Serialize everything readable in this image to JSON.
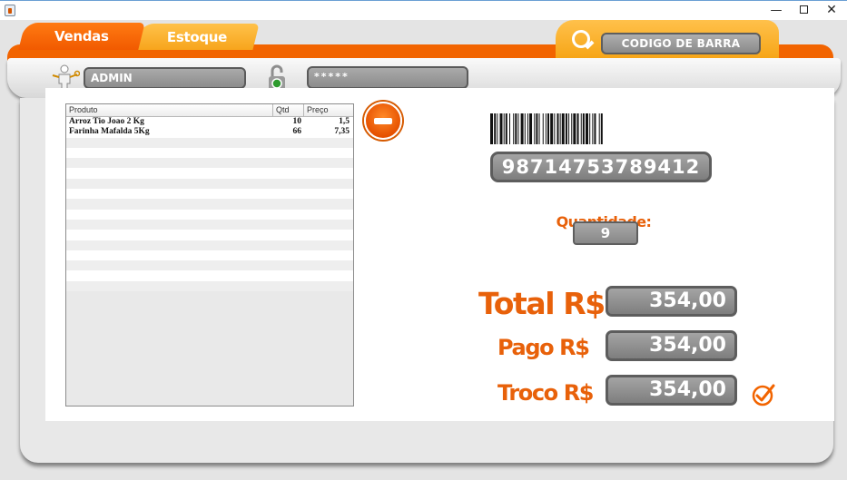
{
  "window": {
    "minimize_glyph": "—",
    "close_glyph": "✕",
    "icons": {
      "app": "java-app-icon",
      "maximize": "maximize-icon"
    }
  },
  "tabs": [
    {
      "label": "Vendas",
      "active": true
    },
    {
      "label": "Estoque",
      "active": false
    }
  ],
  "barcode_search": {
    "label": "CODIGO DE BARRA",
    "icon": "search-icon"
  },
  "login": {
    "user_value": "ADMIN",
    "password_value": "*****",
    "icons": {
      "user": "user-with-key-icon",
      "lock": "unlocked-padlock-icon"
    }
  },
  "table": {
    "columns": [
      "Produto",
      "Qtd",
      "Preço"
    ],
    "rows": [
      [
        "Arroz Tio Joao 2 Kg",
        "10",
        "1,5"
      ],
      [
        "Farinha Mafalda 5Kg",
        "66",
        "7,35"
      ]
    ]
  },
  "remove_button": {
    "icon": "minus-circle-icon"
  },
  "product": {
    "barcode_icon": "barcode-icon",
    "code": "98714753789412",
    "quantity_label": "Quantidade:",
    "quantity": "9"
  },
  "payment": {
    "total_label": "Total R$",
    "total": "354,00",
    "pago_label": "Pago R$",
    "pago": "354,00",
    "troco_label": "Troco R$",
    "troco": "354,00",
    "confirm_icon": "checkmark-circle-icon"
  },
  "colors": {
    "accent_orange": "#f26400",
    "accent_yellow": "#f7a51c",
    "field_gray": "#8c8c8c"
  }
}
